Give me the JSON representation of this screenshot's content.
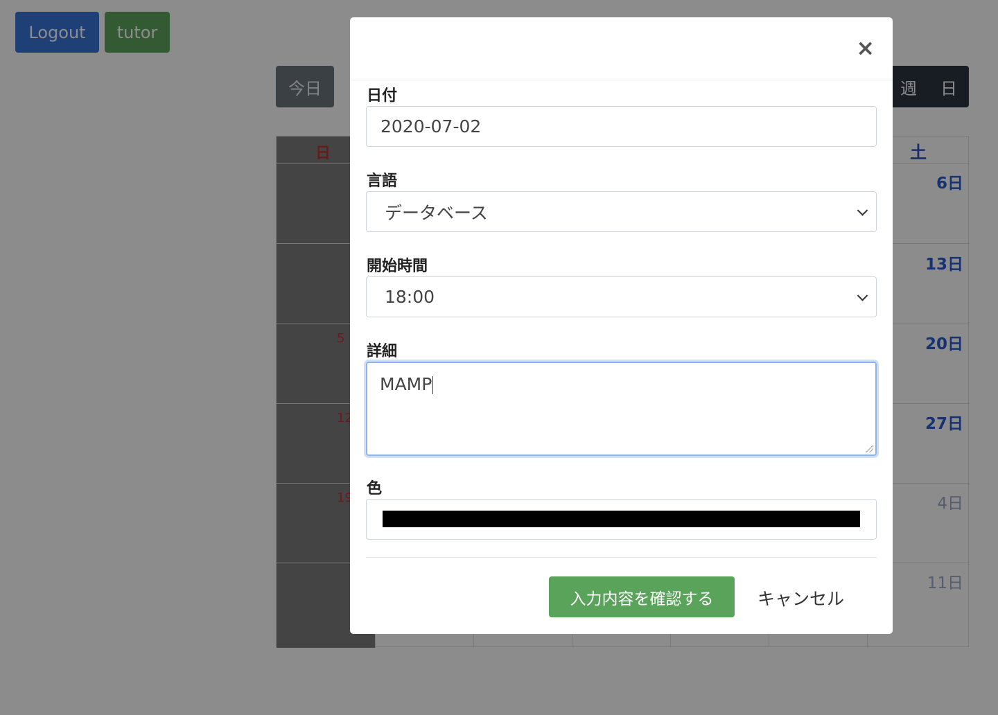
{
  "header": {
    "logout_label": "Logout",
    "tutor_label": "tutor"
  },
  "calendar": {
    "today_label": "今日",
    "view_week": "週",
    "view_day": "日",
    "sunday_header": "日",
    "saturday_header": "土",
    "saturday_days": [
      "6日",
      "13日",
      "20日",
      "27日",
      "4日",
      "11日"
    ],
    "sunday_marks": [
      "5",
      "12",
      "19"
    ]
  },
  "modal": {
    "close_glyph": "×",
    "date": {
      "label": "日付",
      "value": "2020-07-02"
    },
    "language": {
      "label": "言語",
      "selected": "データベース"
    },
    "start_time": {
      "label": "開始時間",
      "selected": "18:00"
    },
    "detail": {
      "label": "詳細",
      "value": "MAMP"
    },
    "color": {
      "label": "色",
      "value": "#000000"
    },
    "confirm_label": "入力内容を確認する",
    "cancel_label": "キャンセル"
  },
  "colors": {
    "primary": "#3a76d8",
    "success": "#5aa35a",
    "saturday": "#2b5bd0",
    "sunday": "#c03030"
  }
}
